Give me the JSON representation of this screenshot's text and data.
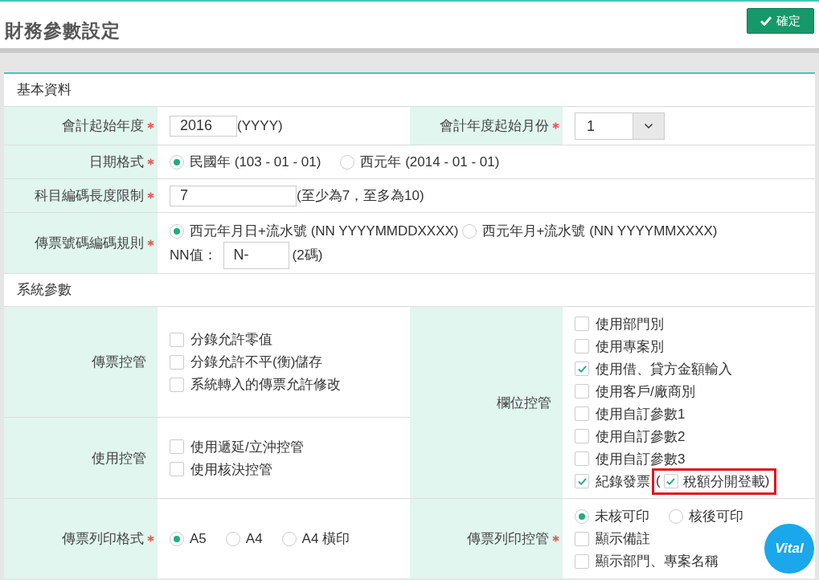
{
  "page_title": "財務參數設定",
  "confirm_button": "確定",
  "basic": {
    "title": "基本資料",
    "fiscal_start_year": {
      "label": "會計起始年度",
      "required": true,
      "value": "2016",
      "hint": "(YYYY)"
    },
    "fiscal_start_month": {
      "label": "會計年度起始月份",
      "required": true,
      "value": "1"
    },
    "date_format": {
      "label": "日期格式",
      "required": true,
      "options": [
        {
          "label": "民國年 (103 - 01 - 01)",
          "selected": true
        },
        {
          "label": "西元年 (2014 - 01 - 01)",
          "selected": false
        }
      ]
    },
    "code_length": {
      "label": "科目編碼長度限制",
      "required": true,
      "value": "7",
      "hint": "(至少為7，至多為10)"
    },
    "voucher_rule": {
      "label": "傳票號碼編碼規則",
      "required": true,
      "options": [
        {
          "label": "西元年月日+流水號 (NN YYYYMMDDXXXX)",
          "selected": true
        },
        {
          "label": "西元年月+流水號 (NN YYYYMMXXXX)",
          "selected": false
        }
      ],
      "prefix_label": "NN值：",
      "prefix_value": "N-",
      "prefix_hint": "(2碼)"
    }
  },
  "system": {
    "title": "系統參數",
    "voucher_control": {
      "label": "傳票控管",
      "options": [
        {
          "label": "分錄允許零值",
          "checked": false
        },
        {
          "label": "分錄允許不平(衡)儲存",
          "checked": false
        },
        {
          "label": "系統轉入的傳票允許修改",
          "checked": false
        }
      ]
    },
    "usage_control": {
      "label": "使用控管",
      "options": [
        {
          "label": "使用遞延/立沖控管",
          "checked": false
        },
        {
          "label": "使用核決控管",
          "checked": false
        }
      ]
    },
    "field_control": {
      "label": "欄位控管",
      "options": [
        {
          "label": "使用部門別",
          "checked": false
        },
        {
          "label": "使用專案別",
          "checked": false
        },
        {
          "label": "使用借、貸方金額輸入",
          "checked": true
        },
        {
          "label": "使用客戶/廠商別",
          "checked": false
        },
        {
          "label": "使用自訂參數1",
          "checked": false
        },
        {
          "label": "使用自訂參數2",
          "checked": false
        },
        {
          "label": "使用自訂參數3",
          "checked": false
        },
        {
          "label": "紀錄發票",
          "checked": true,
          "sub_option": {
            "open_paren": "(",
            "label": "稅額分開登載",
            "checked": true,
            "close_paren": ")",
            "highlighted": true
          }
        }
      ]
    },
    "print_format": {
      "label": "傳票列印格式",
      "required": true,
      "options": [
        {
          "label": "A5",
          "selected": true
        },
        {
          "label": "A4",
          "selected": false
        },
        {
          "label": "A4 橫印",
          "selected": false
        }
      ]
    },
    "print_control": {
      "label": "傳票列印控管",
      "required": true,
      "radios": [
        {
          "label": "未核可印",
          "selected": true
        },
        {
          "label": "核後可印",
          "selected": false
        }
      ],
      "checkboxes": [
        {
          "label": "顯示備註",
          "checked": false
        },
        {
          "label": "顯示部門、專案名稱",
          "checked": false
        }
      ]
    }
  },
  "chat_badge": "Vital"
}
